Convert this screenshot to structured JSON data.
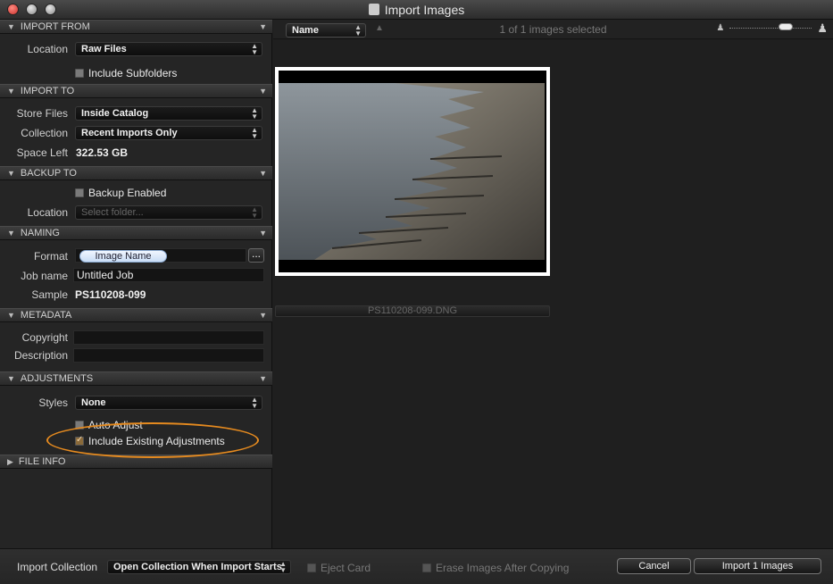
{
  "window": {
    "title": "Import Images"
  },
  "sections": {
    "import_from": {
      "title": "IMPORT FROM",
      "location_label": "Location",
      "location_value": "Raw Files",
      "include_subfolders_label": "Include Subfolders",
      "include_subfolders_checked": false
    },
    "import_to": {
      "title": "IMPORT TO",
      "store_files_label": "Store Files",
      "store_files_value": "Inside Catalog",
      "collection_label": "Collection",
      "collection_value": "Recent Imports Only",
      "space_left_label": "Space Left",
      "space_left_value": "322.53 GB"
    },
    "backup_to": {
      "title": "BACKUP TO",
      "backup_enabled_label": "Backup Enabled",
      "backup_enabled_checked": false,
      "location_label": "Location",
      "location_placeholder": "Select folder..."
    },
    "naming": {
      "title": "NAMING",
      "format_label": "Format",
      "format_token": "Image Name",
      "format_button": "...",
      "job_name_label": "Job name",
      "job_name_value": "Untitled Job",
      "sample_label": "Sample",
      "sample_value": "PS110208-099"
    },
    "metadata": {
      "title": "METADATA",
      "copyright_label": "Copyright",
      "copyright_value": "",
      "description_label": "Description",
      "description_value": ""
    },
    "adjustments": {
      "title": "ADJUSTMENTS",
      "styles_label": "Styles",
      "styles_value": "None",
      "auto_adjust_label": "Auto Adjust",
      "auto_adjust_checked": false,
      "include_existing_label": "Include Existing Adjustments",
      "include_existing_checked": true
    },
    "file_info": {
      "title": "FILE INFO"
    }
  },
  "browser": {
    "sort_value": "Name",
    "selection_status": "1 of 1 images selected",
    "zoom_level": 0.72,
    "thumbnail_filename": "PS110208-099.DNG"
  },
  "bottom": {
    "import_collection_label": "Import Collection",
    "import_collection_value": "Open Collection When Import Starts",
    "eject_card_label": "Eject Card",
    "erase_images_label": "Erase Images After Copying",
    "cancel_label": "Cancel",
    "import_label": "Import 1 Images"
  },
  "colors": {
    "highlight_ring": "#e58a1f",
    "panel_bg": "#252525",
    "browser_bg": "#1f1f1f"
  }
}
